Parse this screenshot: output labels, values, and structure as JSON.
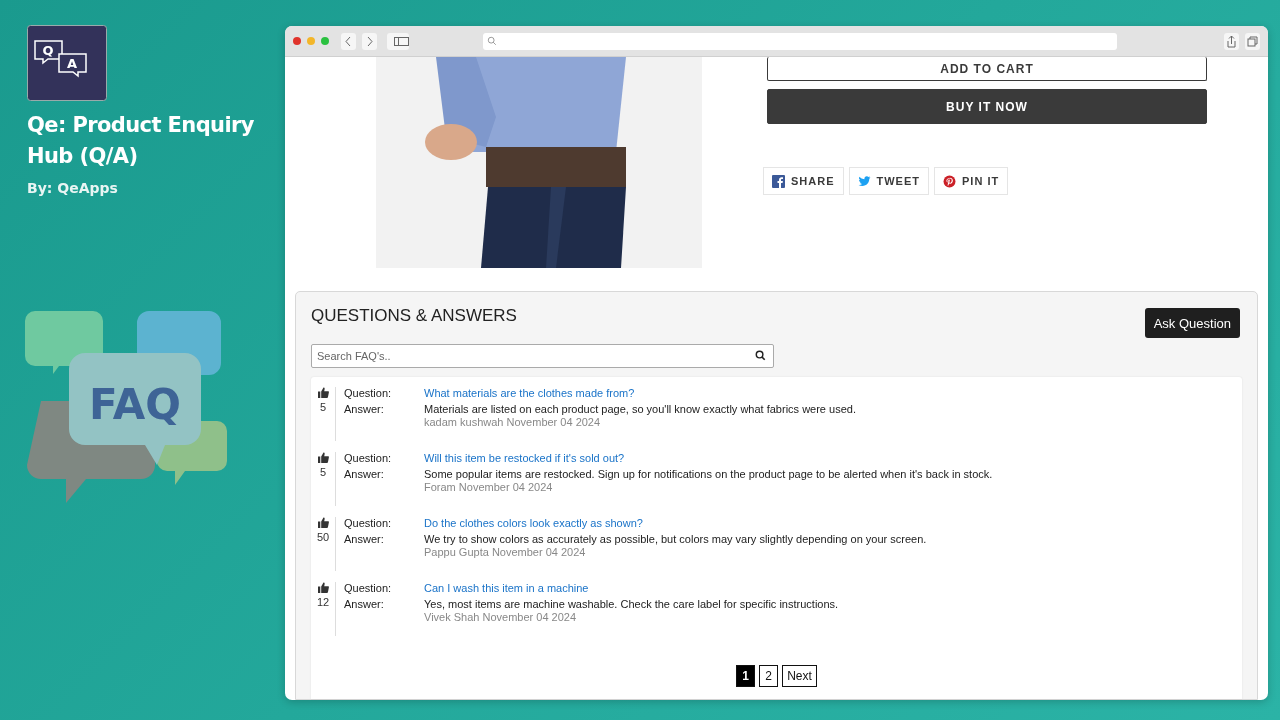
{
  "app": {
    "logo_letters": [
      "Q",
      "A"
    ],
    "title": "Qe: Product Enquiry Hub (Q/A)",
    "byline": "By: QeApps",
    "illustration_text": "FAQ"
  },
  "product": {
    "buttons": [
      {
        "label": "ADD TO CART",
        "kind": "outline"
      },
      {
        "label": "BUY IT NOW",
        "kind": "solid"
      }
    ],
    "share": [
      {
        "label": "SHARE",
        "kind": "facebook"
      },
      {
        "label": "TWEET",
        "kind": "twitter"
      },
      {
        "label": "PIN IT",
        "kind": "pinterest"
      }
    ]
  },
  "qa": {
    "title": "QUESTIONS & ANSWERS",
    "ask_button": "Ask Question",
    "search": {
      "placeholder": "Search FAQ's.."
    },
    "items": [
      {
        "votes": "5",
        "question_label": "Question:",
        "question": "What materials are the clothes made from?",
        "answer_label": "Answer:",
        "answer": "Materials are listed on each product page, so you'll know exactly what fabrics were used.",
        "meta": "kadam kushwah November 04 2024"
      },
      {
        "votes": "5",
        "question_label": "Question:",
        "question": "Will this item be restocked if it's sold out?",
        "answer_label": "Answer:",
        "answer": "Some popular items are restocked. Sign up for notifications on the product page to be alerted when it's back in stock.",
        "meta": "Foram November 04 2024"
      },
      {
        "votes": "50",
        "question_label": "Question:",
        "question": "Do the clothes colors look exactly as shown?",
        "answer_label": "Answer:",
        "answer": "We try to show colors as accurately as possible, but colors may vary slightly depending on your screen.",
        "meta": "Pappu Gupta November 04 2024"
      },
      {
        "votes": "12",
        "question_label": "Question:",
        "question": "Can I wash this item in a machine",
        "answer_label": "Answer:",
        "answer": "Yes, most items are machine washable. Check the care label for specific instructions.",
        "meta": "Vivek Shah November 04 2024"
      }
    ],
    "pagination": [
      {
        "label": "1",
        "selected": true
      },
      {
        "label": "2",
        "selected": false
      },
      {
        "label": "Next",
        "selected": false
      }
    ]
  }
}
